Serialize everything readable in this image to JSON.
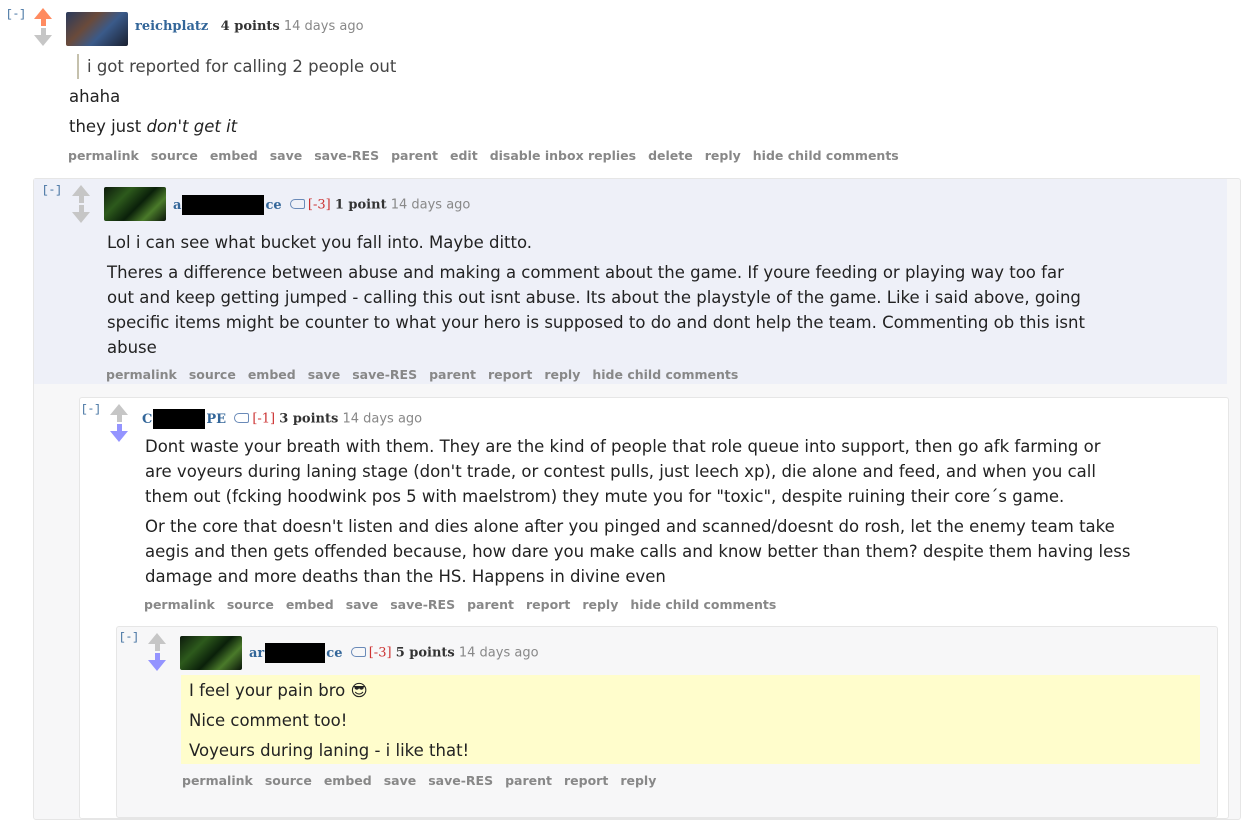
{
  "c1": {
    "toggle": "[-]",
    "author": "reichplatz",
    "score": "4 points",
    "age": "14 days ago",
    "quote": "i got reported for calling 2 people out",
    "line1": "ahaha",
    "line2_prefix": "they just ",
    "line2_em": "don't get it",
    "buttons": [
      "permalink",
      "source",
      "embed",
      "save",
      "save-RES",
      "parent",
      "edit",
      "disable inbox replies",
      "delete",
      "reply",
      "hide child comments"
    ]
  },
  "c2": {
    "toggle": "[-]",
    "author_start": "a",
    "author_end": "ce",
    "karma": "[-3]",
    "score": "1 point",
    "age": "14 days ago",
    "p1": "Lol i can see what bucket you fall into. Maybe ditto.",
    "p2_l1": "Theres a difference between abuse and making a comment about the game. If youre feeding or playing way too far",
    "p2_l2": "out and keep getting jumped - calling this out isnt abuse. Its about the playstyle of the game. Like i said above, going",
    "p2_l3": "specific items might be counter to what your hero is supposed to do and dont help the team. Commenting ob this isnt",
    "p2_l4": "abuse",
    "buttons": [
      "permalink",
      "source",
      "embed",
      "save",
      "save-RES",
      "parent",
      "report",
      "reply",
      "hide child comments"
    ]
  },
  "c3": {
    "toggle": "[-]",
    "author_start": "C",
    "author_end": "PE",
    "karma": "[-1]",
    "score": "3 points",
    "age": "14 days ago",
    "p1_l1": "Dont waste your breath with them. They are the kind of people that role queue into support, then go afk farming or",
    "p1_l2": "are voyeurs during laning stage (don't trade, or contest pulls, just leech xp), die alone and feed, and when you call",
    "p1_l3": "them out (fcking hoodwink pos 5 with maelstrom) they mute you for \"toxic\", despite ruining their core´s game.",
    "p2_l1": "Or the core that doesn't listen and dies alone after you pinged and scanned/doesnt do rosh, let the enemy team take",
    "p2_l2": "aegis and then gets offended because, how dare you make calls and know better than them? despite them having less",
    "p2_l3": "damage and more deaths than the HS. Happens in divine even",
    "buttons": [
      "permalink",
      "source",
      "embed",
      "save",
      "save-RES",
      "parent",
      "report",
      "reply",
      "hide child comments"
    ]
  },
  "c4": {
    "toggle": "[-]",
    "author_start": "ar",
    "author_end": "ce",
    "karma": "[-3]",
    "score": "5 points",
    "age": "14 days ago",
    "p1": "I feel your pain bro 😎",
    "p2": "Nice comment too!",
    "p3": "Voyeurs during laning - i like that!",
    "buttons": [
      "permalink",
      "source",
      "embed",
      "save",
      "save-RES",
      "parent",
      "report",
      "reply"
    ]
  },
  "colors": {
    "upvoted": "#ff8b60",
    "downvoted": "#9494ff",
    "neutral": "#c6c6c6",
    "author": "#336699",
    "highlight": "#fffdcc",
    "nested_bg": "#f7f7f8",
    "self_bg": "#eef0f8"
  }
}
